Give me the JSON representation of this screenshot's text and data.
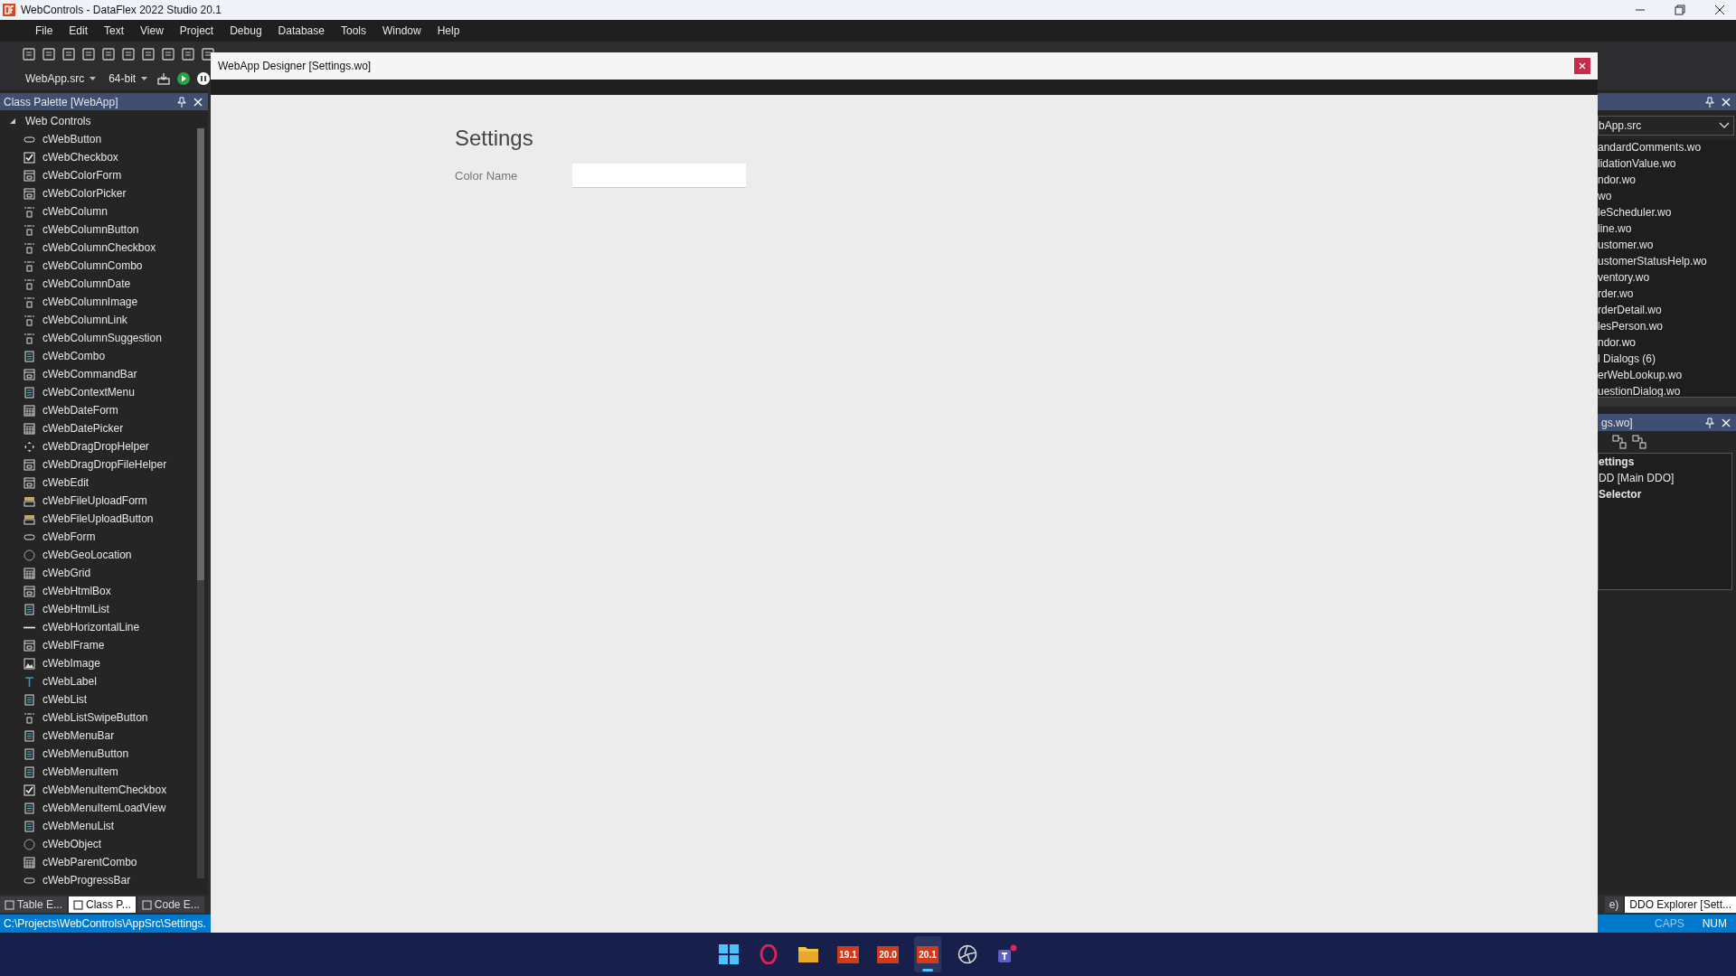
{
  "window": {
    "title": "WebControls - DataFlex 2022 Studio 20.1"
  },
  "menu": [
    "File",
    "Edit",
    "Text",
    "View",
    "Project",
    "Debug",
    "Database",
    "Tools",
    "Window",
    "Help"
  ],
  "toolbar": {
    "workspace": "WebApp.src",
    "platform": "64-bit"
  },
  "class_palette": {
    "title": "Class Palette [WebApp]",
    "tree": [
      {
        "label": "Web Controls",
        "expanded": true,
        "children": [
          {
            "label": "cWebButton",
            "kind": "button"
          },
          {
            "label": "cWebCheckbox",
            "kind": "checkbox"
          },
          {
            "label": "cWebColorForm",
            "kind": "form"
          },
          {
            "label": "cWebColorPicker",
            "kind": "form"
          },
          {
            "label": "cWebColumn",
            "kind": "column"
          },
          {
            "label": "cWebColumnButton",
            "kind": "column"
          },
          {
            "label": "cWebColumnCheckbox",
            "kind": "column"
          },
          {
            "label": "cWebColumnCombo",
            "kind": "column"
          },
          {
            "label": "cWebColumnDate",
            "kind": "column"
          },
          {
            "label": "cWebColumnImage",
            "kind": "column"
          },
          {
            "label": "cWebColumnLink",
            "kind": "column"
          },
          {
            "label": "cWebColumnSuggestion",
            "kind": "column"
          },
          {
            "label": "cWebCombo",
            "kind": "list"
          },
          {
            "label": "cWebCommandBar",
            "kind": "form"
          },
          {
            "label": "cWebContextMenu",
            "kind": "list"
          },
          {
            "label": "cWebDateForm",
            "kind": "grid"
          },
          {
            "label": "cWebDatePicker",
            "kind": "grid"
          },
          {
            "label": "cWebDragDropHelper",
            "kind": "move"
          },
          {
            "label": "cWebDragDropFileHelper",
            "kind": "form"
          },
          {
            "label": "cWebEdit",
            "kind": "form"
          },
          {
            "label": "cWebFileUploadForm",
            "kind": "folder"
          },
          {
            "label": "cWebFileUploadButton",
            "kind": "folder"
          },
          {
            "label": "cWebForm",
            "kind": "button"
          },
          {
            "label": "cWebGeoLocation",
            "kind": "globe"
          },
          {
            "label": "cWebGrid",
            "kind": "grid"
          },
          {
            "label": "cWebHtmlBox",
            "kind": "form"
          },
          {
            "label": "cWebHtmlList",
            "kind": "list"
          },
          {
            "label": "cWebHorizontalLine",
            "kind": "line"
          },
          {
            "label": "cWebIFrame",
            "kind": "form"
          },
          {
            "label": "cWebImage",
            "kind": "image"
          },
          {
            "label": "cWebLabel",
            "kind": "text"
          },
          {
            "label": "cWebList",
            "kind": "list"
          },
          {
            "label": "cWebListSwipeButton",
            "kind": "column"
          },
          {
            "label": "cWebMenuBar",
            "kind": "list"
          },
          {
            "label": "cWebMenuButton",
            "kind": "list"
          },
          {
            "label": "cWebMenuItem",
            "kind": "list"
          },
          {
            "label": "cWebMenuItemCheckbox",
            "kind": "checkbox"
          },
          {
            "label": "cWebMenuItemLoadView",
            "kind": "list"
          },
          {
            "label": "cWebMenuList",
            "kind": "list"
          },
          {
            "label": "cWebObject",
            "kind": "globe"
          },
          {
            "label": "cWebParentCombo",
            "kind": "grid"
          },
          {
            "label": "cWebProgressBar",
            "kind": "button"
          }
        ]
      }
    ]
  },
  "designer": {
    "title": "WebApp Designer [Settings.wo]",
    "heading": "Settings",
    "field": {
      "label": "Color Name"
    }
  },
  "workspace_panel": {
    "dropdown": "bApp.src",
    "items": [
      "andardComments.wo",
      "lidationValue.wo",
      "ndor.wo",
      "wo",
      "leScheduler.wo",
      "line.wo",
      "ustomer.wo",
      "ustomerStatusHelp.wo",
      "ventory.wo",
      "rder.wo",
      "rderDetail.wo",
      "lesPerson.wo",
      "ndor.wo",
      "l Dialogs (6)",
      "erWebLookup.wo",
      "uestionDialog.wo"
    ]
  },
  "ddo_panel": {
    "title": "gs.wo]",
    "tree": [
      {
        "label": "ettings",
        "bold": true
      },
      {
        "label": "DD [Main DDO]",
        "bold": false
      },
      {
        "label": "Selector",
        "bold": true
      }
    ]
  },
  "bottom_tabs_left": [
    {
      "label": "Table E...",
      "selected": false
    },
    {
      "label": "Class P...",
      "selected": true
    },
    {
      "label": "Code E...",
      "selected": false
    }
  ],
  "bottom_tabs_right": [
    {
      "label": "e)",
      "selected": false
    },
    {
      "label": "DDO Explorer [Sett...",
      "selected": true
    }
  ],
  "status_bar": {
    "path": "C:\\Projects\\WebControls\\AppSrc\\Settings.",
    "indicators": [
      {
        "label": "CAPS",
        "on": false
      },
      {
        "label": "NUM",
        "on": true
      }
    ]
  },
  "taskbar": [
    {
      "kind": "start",
      "selected": false
    },
    {
      "kind": "browser",
      "selected": false
    },
    {
      "kind": "folder",
      "selected": false
    },
    {
      "kind": "version",
      "label": "19.1",
      "selected": false
    },
    {
      "kind": "version",
      "label": "20.0",
      "selected": false
    },
    {
      "kind": "version",
      "label": "20.1",
      "selected": true
    },
    {
      "kind": "aperture",
      "selected": false
    },
    {
      "kind": "chat",
      "selected": false
    }
  ]
}
